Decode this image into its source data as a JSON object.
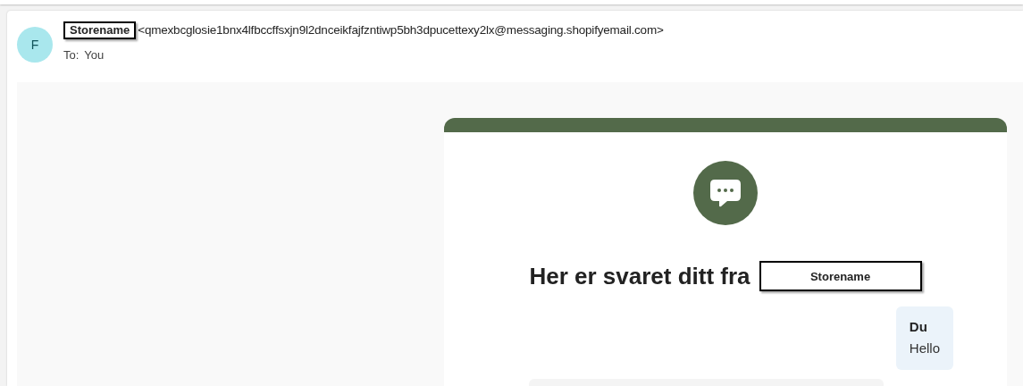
{
  "sender": {
    "avatar_letter": "F",
    "name": "Storename",
    "address": "<qmexbcglosie1bnx4lfbccffsxjn9l2dnceikfajfzntiwp5bh3dpucettexy2lx@messaging.shopifyemail.com>"
  },
  "recipient": {
    "label": "To:",
    "value": "You"
  },
  "email": {
    "heading": "Her er svaret ditt fra",
    "store_name": "Storename",
    "messages": [
      {
        "author": "Du",
        "text": "Hello"
      }
    ]
  }
}
